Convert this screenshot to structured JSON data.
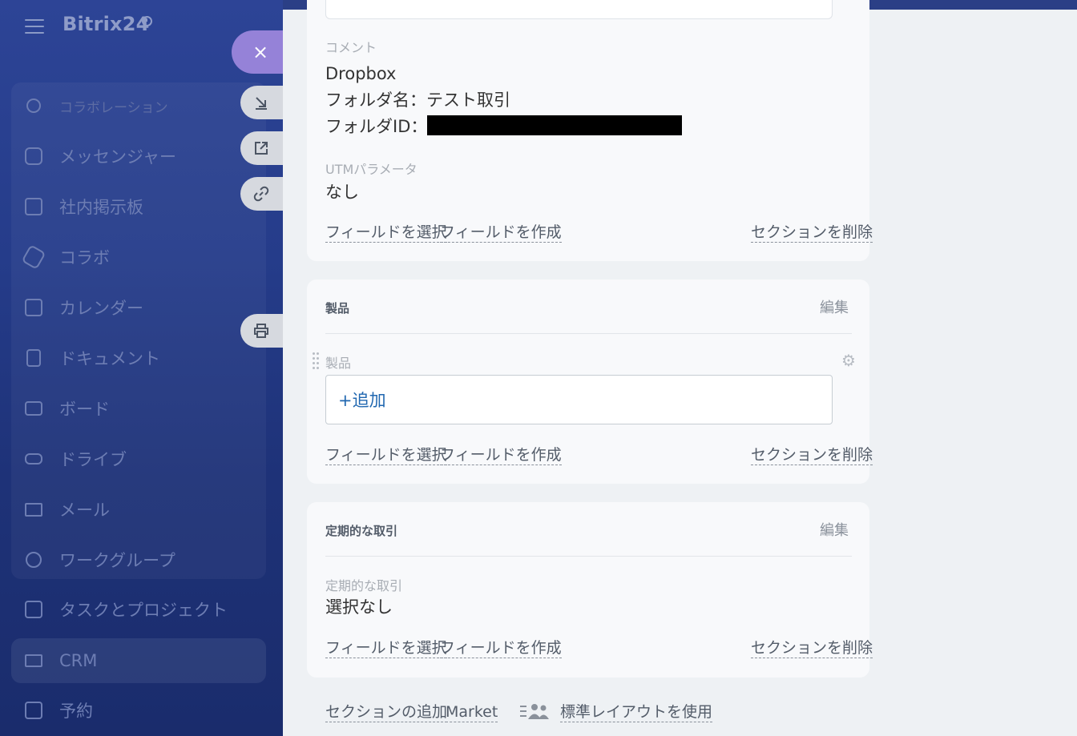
{
  "app": {
    "logo": "Bitrix24"
  },
  "sidebar": {
    "items": [
      {
        "label": "コラボレーション",
        "icon": "collaboration-icon"
      },
      {
        "label": "メッセンジャー",
        "icon": "chat-icon"
      },
      {
        "label": "社内掲示板",
        "icon": "newsfeed-icon"
      },
      {
        "label": "コラボ",
        "icon": "collab-hex-icon"
      },
      {
        "label": "カレンダー",
        "icon": "calendar-icon"
      },
      {
        "label": "ドキュメント",
        "icon": "document-icon"
      },
      {
        "label": "ボード",
        "icon": "board-icon"
      },
      {
        "label": "ドライブ",
        "icon": "drive-icon"
      },
      {
        "label": "メール",
        "icon": "mail-icon"
      },
      {
        "label": "ワークグループ",
        "icon": "workgroup-icon"
      },
      {
        "label": "タスクとプロジェクト",
        "icon": "task-icon"
      },
      {
        "label": "CRM",
        "icon": "crm-icon"
      },
      {
        "label": "予約",
        "icon": "booking-icon"
      }
    ]
  },
  "actions": {
    "close": "×",
    "icons": [
      "collapse-icon",
      "open-new-window-icon",
      "link-icon",
      "print-icon"
    ]
  },
  "section1": {
    "comment_label": "コメント",
    "comment_line1": "Dropbox",
    "comment_line2": "フォルダ名：テスト取引",
    "comment_line3": "フォルダID：",
    "utm_label": "UTMパラメータ",
    "utm_value": "なし"
  },
  "section2": {
    "title": "製品",
    "edit": "編集",
    "field_label": "製品",
    "add_button": "+追加"
  },
  "section3": {
    "title": "定期的な取引",
    "edit": "編集",
    "field_label": "定期的な取引",
    "field_value": "選択なし"
  },
  "section_links": {
    "select_field": "フィールドを選択",
    "create_field": "フィールドを作成",
    "delete_section": "セクションを削除"
  },
  "footer": {
    "add_section": "セクションの追加",
    "market": "Market",
    "use_standard_layout": "標準レイアウトを使用"
  }
}
